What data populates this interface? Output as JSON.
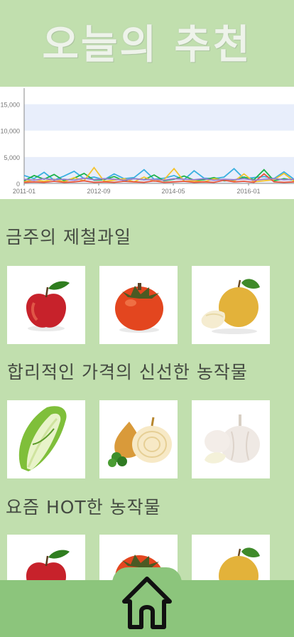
{
  "header": {
    "title": "오늘의 추천"
  },
  "chart_data": {
    "type": "line",
    "title": "",
    "xlabel": "",
    "ylabel": "",
    "x_ticks": [
      "2011-01",
      "2012-09",
      "2014-05",
      "2016-01"
    ],
    "y_ticks": [
      "0",
      "5,000",
      "10,000",
      "15,000"
    ],
    "ylim": [
      0,
      17500
    ],
    "grid": "horizontal bands",
    "series": [
      {
        "color": "#3ab0e0",
        "values": [
          1500,
          900,
          2100,
          600,
          1400,
          2300,
          900,
          1200,
          700,
          1800,
          900,
          1100,
          2600,
          800,
          1000,
          1500,
          700,
          2400,
          1000,
          900,
          1200,
          2800,
          900,
          1100,
          1300,
          900,
          2200,
          800
        ]
      },
      {
        "color": "#1fb34a",
        "values": [
          500,
          1500,
          800,
          1700,
          500,
          1000,
          1900,
          600,
          700,
          1300,
          500,
          900,
          700,
          1600,
          500,
          800,
          1400,
          600,
          700,
          1100,
          500,
          600,
          1200,
          700,
          2600,
          500,
          900,
          600
        ]
      },
      {
        "color": "#f4c430",
        "values": [
          300,
          700,
          400,
          800,
          300,
          1100,
          500,
          3000,
          400,
          600,
          900,
          300,
          1200,
          400,
          700,
          2800,
          400,
          500,
          300,
          900,
          600,
          400,
          1800,
          300,
          500,
          700,
          1900,
          400
        ]
      },
      {
        "color": "#e8553d",
        "values": [
          200,
          300,
          200,
          400,
          200,
          300,
          500,
          200,
          300,
          200,
          400,
          300,
          200,
          500,
          200,
          300,
          400,
          200,
          300,
          200,
          600,
          300,
          400,
          200,
          1800,
          300,
          200,
          300
        ]
      },
      {
        "color": "#9b7fcf",
        "values": [
          800,
          600,
          900,
          700,
          800,
          600,
          1000,
          700,
          900,
          800,
          600,
          900,
          700,
          800,
          600,
          900,
          800,
          700,
          900,
          600,
          800,
          700,
          900,
          600,
          800,
          900,
          700,
          800
        ]
      }
    ]
  },
  "sections": [
    {
      "heading": "금주의 제철과일",
      "items": [
        {
          "name": "apple",
          "icon": "apple-image"
        },
        {
          "name": "persimmon",
          "icon": "persimmon-image"
        },
        {
          "name": "pear",
          "icon": "pear-image"
        }
      ]
    },
    {
      "heading": "합리적인 가격의 신선한 농작물",
      "items": [
        {
          "name": "napa cabbage",
          "icon": "napa-cabbage-image"
        },
        {
          "name": "onion",
          "icon": "onion-image"
        },
        {
          "name": "garlic",
          "icon": "garlic-image"
        }
      ]
    },
    {
      "heading": "요즘 HOT한 농작물",
      "items": [
        {
          "name": "apple",
          "icon": "apple-image"
        },
        {
          "name": "persimmon",
          "icon": "persimmon-image"
        },
        {
          "name": "pear",
          "icon": "pear-image"
        }
      ]
    }
  ],
  "navigation": {
    "home_icon": "home-icon"
  },
  "colors": {
    "background": "#c1dfae",
    "bottom_bar": "#8cc57c",
    "heading_text": "#444a41",
    "title_text": "#eef3ea"
  }
}
